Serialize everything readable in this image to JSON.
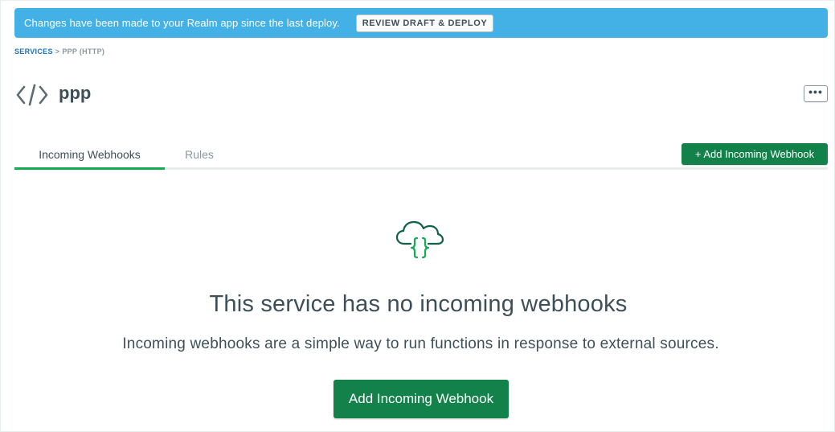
{
  "banner": {
    "message": "Changes have been made to your Realm app since the last deploy.",
    "button_label": "REVIEW DRAFT & DEPLOY",
    "color": "#43b1e5"
  },
  "breadcrumb": {
    "parent": "SERVICES",
    "separator": ">",
    "current": "PPP (HTTP)"
  },
  "header": {
    "icon": "code-brackets-icon",
    "title": "ppp",
    "more_label": "•••"
  },
  "tabs": [
    {
      "label": "Incoming Webhooks",
      "active": true
    },
    {
      "label": "Rules",
      "active": false
    }
  ],
  "actions": {
    "add_small_label": "+ Add Incoming Webhook",
    "accent_color": "#13814a"
  },
  "empty_state": {
    "icon": "cloud-braces-icon",
    "title": "This service has no incoming webhooks",
    "description": "Incoming webhooks are a simple way to run functions in response to external sources.",
    "button_label": "Add Incoming Webhook"
  }
}
